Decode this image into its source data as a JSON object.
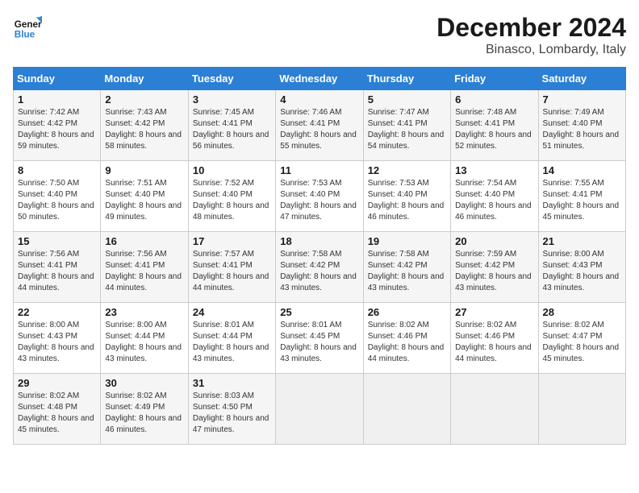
{
  "header": {
    "logo_line1": "General",
    "logo_line2": "Blue",
    "title": "December 2024",
    "subtitle": "Binasco, Lombardy, Italy"
  },
  "weekdays": [
    "Sunday",
    "Monday",
    "Tuesday",
    "Wednesday",
    "Thursday",
    "Friday",
    "Saturday"
  ],
  "weeks": [
    [
      {
        "day": "1",
        "rise": "7:42 AM",
        "set": "4:42 PM",
        "daylight": "8 hours and 59 minutes."
      },
      {
        "day": "2",
        "rise": "7:43 AM",
        "set": "4:42 PM",
        "daylight": "8 hours and 58 minutes."
      },
      {
        "day": "3",
        "rise": "7:45 AM",
        "set": "4:41 PM",
        "daylight": "8 hours and 56 minutes."
      },
      {
        "day": "4",
        "rise": "7:46 AM",
        "set": "4:41 PM",
        "daylight": "8 hours and 55 minutes."
      },
      {
        "day": "5",
        "rise": "7:47 AM",
        "set": "4:41 PM",
        "daylight": "8 hours and 54 minutes."
      },
      {
        "day": "6",
        "rise": "7:48 AM",
        "set": "4:41 PM",
        "daylight": "8 hours and 52 minutes."
      },
      {
        "day": "7",
        "rise": "7:49 AM",
        "set": "4:40 PM",
        "daylight": "8 hours and 51 minutes."
      }
    ],
    [
      {
        "day": "8",
        "rise": "7:50 AM",
        "set": "4:40 PM",
        "daylight": "8 hours and 50 minutes."
      },
      {
        "day": "9",
        "rise": "7:51 AM",
        "set": "4:40 PM",
        "daylight": "8 hours and 49 minutes."
      },
      {
        "day": "10",
        "rise": "7:52 AM",
        "set": "4:40 PM",
        "daylight": "8 hours and 48 minutes."
      },
      {
        "day": "11",
        "rise": "7:53 AM",
        "set": "4:40 PM",
        "daylight": "8 hours and 47 minutes."
      },
      {
        "day": "12",
        "rise": "7:53 AM",
        "set": "4:40 PM",
        "daylight": "8 hours and 46 minutes."
      },
      {
        "day": "13",
        "rise": "7:54 AM",
        "set": "4:40 PM",
        "daylight": "8 hours and 46 minutes."
      },
      {
        "day": "14",
        "rise": "7:55 AM",
        "set": "4:41 PM",
        "daylight": "8 hours and 45 minutes."
      }
    ],
    [
      {
        "day": "15",
        "rise": "7:56 AM",
        "set": "4:41 PM",
        "daylight": "8 hours and 44 minutes."
      },
      {
        "day": "16",
        "rise": "7:56 AM",
        "set": "4:41 PM",
        "daylight": "8 hours and 44 minutes."
      },
      {
        "day": "17",
        "rise": "7:57 AM",
        "set": "4:41 PM",
        "daylight": "8 hours and 44 minutes."
      },
      {
        "day": "18",
        "rise": "7:58 AM",
        "set": "4:42 PM",
        "daylight": "8 hours and 43 minutes."
      },
      {
        "day": "19",
        "rise": "7:58 AM",
        "set": "4:42 PM",
        "daylight": "8 hours and 43 minutes."
      },
      {
        "day": "20",
        "rise": "7:59 AM",
        "set": "4:42 PM",
        "daylight": "8 hours and 43 minutes."
      },
      {
        "day": "21",
        "rise": "8:00 AM",
        "set": "4:43 PM",
        "daylight": "8 hours and 43 minutes."
      }
    ],
    [
      {
        "day": "22",
        "rise": "8:00 AM",
        "set": "4:43 PM",
        "daylight": "8 hours and 43 minutes."
      },
      {
        "day": "23",
        "rise": "8:00 AM",
        "set": "4:44 PM",
        "daylight": "8 hours and 43 minutes."
      },
      {
        "day": "24",
        "rise": "8:01 AM",
        "set": "4:44 PM",
        "daylight": "8 hours and 43 minutes."
      },
      {
        "day": "25",
        "rise": "8:01 AM",
        "set": "4:45 PM",
        "daylight": "8 hours and 43 minutes."
      },
      {
        "day": "26",
        "rise": "8:02 AM",
        "set": "4:46 PM",
        "daylight": "8 hours and 44 minutes."
      },
      {
        "day": "27",
        "rise": "8:02 AM",
        "set": "4:46 PM",
        "daylight": "8 hours and 44 minutes."
      },
      {
        "day": "28",
        "rise": "8:02 AM",
        "set": "4:47 PM",
        "daylight": "8 hours and 45 minutes."
      }
    ],
    [
      {
        "day": "29",
        "rise": "8:02 AM",
        "set": "4:48 PM",
        "daylight": "8 hours and 45 minutes."
      },
      {
        "day": "30",
        "rise": "8:02 AM",
        "set": "4:49 PM",
        "daylight": "8 hours and 46 minutes."
      },
      {
        "day": "31",
        "rise": "8:03 AM",
        "set": "4:50 PM",
        "daylight": "8 hours and 47 minutes."
      },
      null,
      null,
      null,
      null
    ]
  ],
  "labels": {
    "sunrise": "Sunrise:",
    "sunset": "Sunset:",
    "daylight": "Daylight:"
  }
}
